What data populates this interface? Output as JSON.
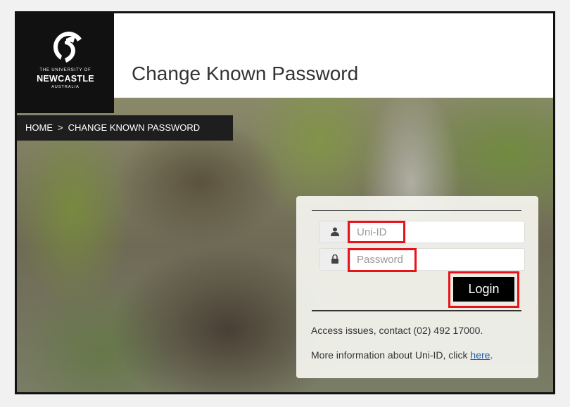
{
  "header": {
    "title": "Change Known Password",
    "logo": {
      "line1": "THE UNIVERSITY OF",
      "line2": "NEWCASTLE",
      "line3": "AUSTRALIA",
      "icon": "seahorse-crest-icon"
    }
  },
  "breadcrumb": {
    "home": "HOME",
    "separator": ">",
    "current": "CHANGE KNOWN PASSWORD"
  },
  "login": {
    "uni_id_placeholder": "Uni-ID",
    "password_placeholder": "Password",
    "button_label": "Login",
    "user_icon": "user-icon",
    "lock_icon": "lock-icon"
  },
  "info": {
    "access_issues": "Access issues, contact (02) 492 17000.",
    "more_info_prefix": "More information about Uni-ID, click ",
    "more_info_link": "here",
    "more_info_suffix": "."
  },
  "colors": {
    "highlight": "#e8131a",
    "header_bg": "#111111",
    "link": "#1a5bb0"
  }
}
